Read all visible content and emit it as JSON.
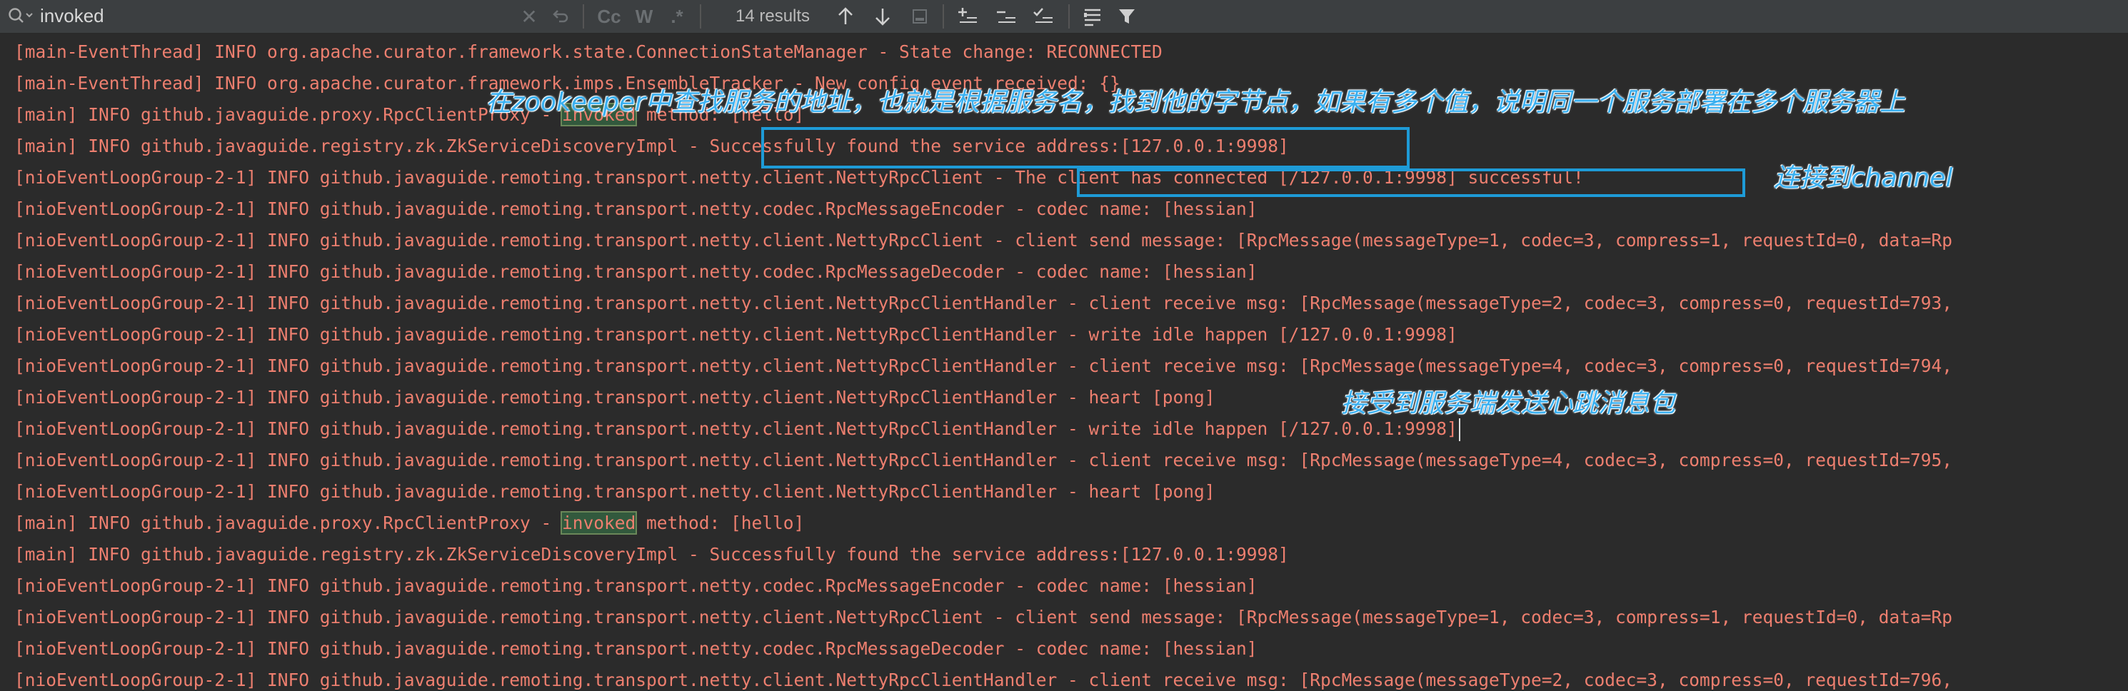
{
  "search": {
    "query": "invoked",
    "results_label": "14 results",
    "match_case_label": "Cc",
    "words_label": "W",
    "regex_label": ".*"
  },
  "icons": {
    "search": "magnifier-icon",
    "clear": "close-icon",
    "replace_history": "undo-icon",
    "prev": "arrow-up-icon",
    "next": "arrow-down-icon",
    "select": "select-occurrence-icon",
    "add_selection": "add-selection-icon",
    "remove_selection": "remove-selection-icon",
    "select_all": "select-all-occurrences-icon",
    "in_selection": "in-selection-icon",
    "filter": "filter-icon"
  },
  "console": {
    "lines": [
      "[main-EventThread] INFO org.apache.curator.framework.state.ConnectionStateManager - State change: RECONNECTED",
      "[main-EventThread] INFO org.apache.curator.framework.imps.EnsembleTracker - New config event received: {}",
      {
        "pre": "[main] INFO github.javaguide.proxy.RpcClientProxy - ",
        "match": "invoked",
        "post": " method: [hello]"
      },
      "[main] INFO github.javaguide.registry.zk.ZkServiceDiscoveryImpl - Successfully found the service address:[127.0.0.1:9998]",
      "[nioEventLoopGroup-2-1] INFO github.javaguide.remoting.transport.netty.client.NettyRpcClient - The client has connected [/127.0.0.1:9998] successful!",
      "[nioEventLoopGroup-2-1] INFO github.javaguide.remoting.transport.netty.codec.RpcMessageEncoder - codec name: [hessian]",
      "[nioEventLoopGroup-2-1] INFO github.javaguide.remoting.transport.netty.client.NettyRpcClient - client send message: [RpcMessage(messageType=1, codec=3, compress=1, requestId=0, data=Rp",
      "[nioEventLoopGroup-2-1] INFO github.javaguide.remoting.transport.netty.codec.RpcMessageDecoder - codec name: [hessian]",
      "[nioEventLoopGroup-2-1] INFO github.javaguide.remoting.transport.netty.client.NettyRpcClientHandler - client receive msg: [RpcMessage(messageType=2, codec=3, compress=0, requestId=793,",
      "[nioEventLoopGroup-2-1] INFO github.javaguide.remoting.transport.netty.client.NettyRpcClientHandler - write idle happen [/127.0.0.1:9998]",
      "[nioEventLoopGroup-2-1] INFO github.javaguide.remoting.transport.netty.client.NettyRpcClientHandler - client receive msg: [RpcMessage(messageType=4, codec=3, compress=0, requestId=794,",
      "[nioEventLoopGroup-2-1] INFO github.javaguide.remoting.transport.netty.client.NettyRpcClientHandler - heart [pong]",
      "[nioEventLoopGroup-2-1] INFO github.javaguide.remoting.transport.netty.client.NettyRpcClientHandler - write idle happen [/127.0.0.1:9998]",
      "[nioEventLoopGroup-2-1] INFO github.javaguide.remoting.transport.netty.client.NettyRpcClientHandler - client receive msg: [RpcMessage(messageType=4, codec=3, compress=0, requestId=795,",
      "[nioEventLoopGroup-2-1] INFO github.javaguide.remoting.transport.netty.client.NettyRpcClientHandler - heart [pong]",
      {
        "pre": "[main] INFO github.javaguide.proxy.RpcClientProxy - ",
        "match": "invoked",
        "post": " method: [hello]"
      },
      "[main] INFO github.javaguide.registry.zk.ZkServiceDiscoveryImpl - Successfully found the service address:[127.0.0.1:9998]",
      "[nioEventLoopGroup-2-1] INFO github.javaguide.remoting.transport.netty.codec.RpcMessageEncoder - codec name: [hessian]",
      "[nioEventLoopGroup-2-1] INFO github.javaguide.remoting.transport.netty.client.NettyRpcClient - client send message: [RpcMessage(messageType=1, codec=3, compress=1, requestId=0, data=Rp",
      "[nioEventLoopGroup-2-1] INFO github.javaguide.remoting.transport.netty.codec.RpcMessageDecoder - codec name: [hessian]",
      "[nioEventLoopGroup-2-1] INFO github.javaguide.remoting.transport.netty.client.NettyRpcClientHandler - client receive msg: [RpcMessage(messageType=2, codec=3, compress=0, requestId=796,"
    ]
  },
  "annotations": {
    "zk_lookup": "在zookeeper中查找服务的地址，也就是根据服务名，找到他的字节点，如果有多个值，说明同一个服务部署在多个服务器上",
    "channel": "连接到channel",
    "heartbeat": "接受到服务端发送心跳消息包"
  },
  "colors": {
    "console_bg": "#2b2b2b",
    "log_text": "#ed7f6f",
    "match_highlight": "#32593d",
    "annotation_blue": "#1e9bd7",
    "toolbar_bg": "#3c3f41"
  }
}
